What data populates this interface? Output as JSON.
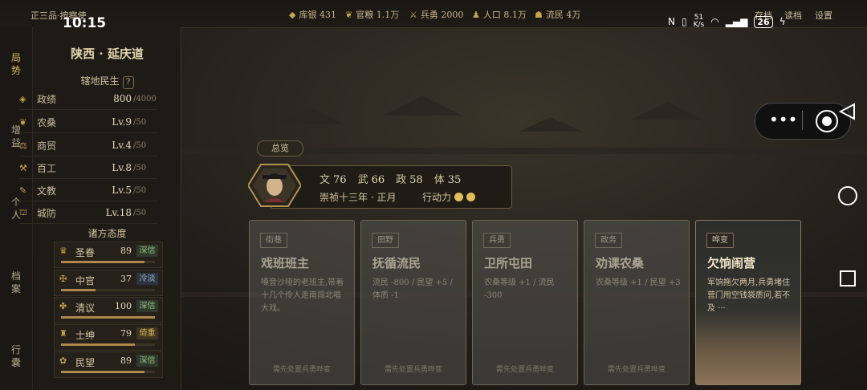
{
  "topbar": {
    "rank": "正三品·按察使",
    "time": "10:15",
    "resources": [
      {
        "icon": "silver-icon",
        "label": "库银 431"
      },
      {
        "icon": "grain-icon",
        "label": "官粮 1.1万"
      },
      {
        "icon": "soldier-icon",
        "label": "兵勇 2000"
      },
      {
        "icon": "population-icon",
        "label": "人口 8.1万"
      },
      {
        "icon": "refugee-icon",
        "label": "流民 4万"
      }
    ],
    "links": {
      "save": "存档",
      "load": "读档",
      "settings": "设置"
    },
    "status": {
      "net": "51",
      "net_unit": "K/s",
      "battery": "26"
    }
  },
  "nav": {
    "items": [
      "局势",
      "增益",
      "个人",
      "档案",
      "行囊"
    ],
    "active": 0
  },
  "province": {
    "name": "陕西 · 延庆道",
    "stats_title": "辖地民生",
    "help": "?",
    "stats": [
      {
        "icon": "policy-icon",
        "label": "政绩",
        "value": "800",
        "max": "/4000"
      },
      {
        "icon": "farm-icon",
        "label": "农桑",
        "value": "Lv.9",
        "max": "/50"
      },
      {
        "icon": "trade-icon",
        "label": "商贸",
        "value": "Lv.4",
        "max": "/50"
      },
      {
        "icon": "craft-icon",
        "label": "百工",
        "value": "Lv.8",
        "max": "/50"
      },
      {
        "icon": "education-icon",
        "label": "文教",
        "value": "Lv.5",
        "max": "/50"
      },
      {
        "icon": "defense-icon",
        "label": "城防",
        "value": "Lv.18",
        "max": "/50"
      }
    ],
    "attitude_title": "诸方态度",
    "attitudes": [
      {
        "icon": "imperial-icon",
        "label": "圣眷",
        "value": "89",
        "badge": "深信",
        "badge_type": "trust",
        "level": 0.89
      },
      {
        "icon": "eunuch-icon",
        "label": "中官",
        "value": "37",
        "badge": "冷淡",
        "badge_type": "cold",
        "level": 0.37
      },
      {
        "icon": "scholar-icon",
        "label": "清议",
        "value": "100",
        "badge": "深信",
        "badge_type": "trust",
        "level": 1.0
      },
      {
        "icon": "gentry-icon",
        "label": "士绅",
        "value": "79",
        "badge": "倚重",
        "badge_type": "lean",
        "level": 0.79
      },
      {
        "icon": "people-icon",
        "label": "民望",
        "value": "89",
        "badge": "深信",
        "badge_type": "trust",
        "level": 0.89
      }
    ]
  },
  "overview": {
    "tab": "总览",
    "stats": [
      {
        "label": "文",
        "value": "76"
      },
      {
        "label": "武",
        "value": "66"
      },
      {
        "label": "政",
        "value": "58"
      },
      {
        "label": "体",
        "value": "35"
      }
    ],
    "date": "崇祯十三年 · 正月",
    "action_label": "行动力",
    "action_points": 2
  },
  "cards": [
    {
      "tag": "街巷",
      "title": "戏班班主",
      "desc": "嗓音沙哑的老班主,带着十几个伶人走南闯北唱大戏。",
      "footer": "需先处置兵勇哗变",
      "active": false
    },
    {
      "tag": "田野",
      "title": "抚循流民",
      "desc": "流民 -800 / 民望 +5 / 体质 -1",
      "footer": "需先处置兵勇哗变",
      "active": false
    },
    {
      "tag": "兵勇",
      "title": "卫所屯田",
      "desc": "农桑等级 +1 / 流民 -300",
      "footer": "需先处置兵勇哗变",
      "active": false
    },
    {
      "tag": "政务",
      "title": "劝课农桑",
      "desc": "农桑等级 +1 / 民望 +3",
      "footer": "需先处置兵勇哗变",
      "active": false
    },
    {
      "tag": "哗变",
      "title": "欠饷闹营",
      "desc": "军饷拖欠两月,兵勇堵住营门甩空钱袋质问,若不及 ···",
      "footer": "",
      "active": true
    }
  ]
}
